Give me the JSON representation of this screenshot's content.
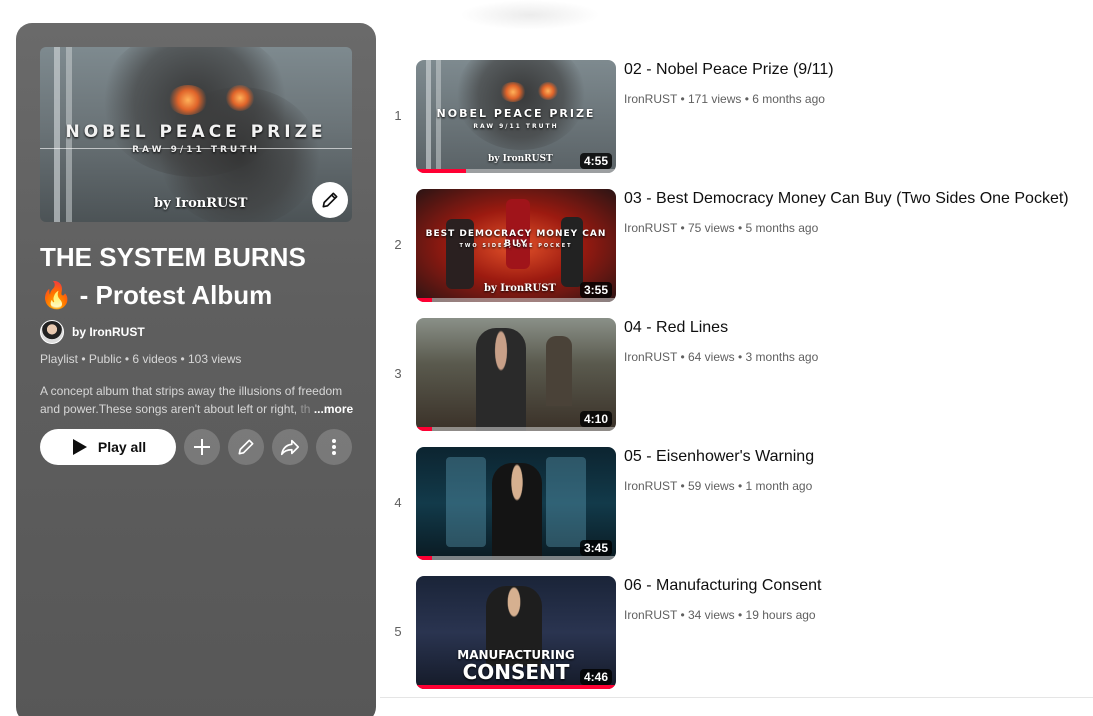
{
  "playlist": {
    "thumb_title": "NOBEL PEACE PRIZE",
    "thumb_subtitle": "RAW 9/11 TRUTH",
    "thumb_by": "by IronRUST",
    "title_line1": "THE SYSTEM BURNS",
    "title_emoji": "🔥",
    "title_line2": " - Protest Album",
    "owner": "by IronRUST",
    "meta": "Playlist • Public • 6 videos • 103 views",
    "description_line1": "A concept album that strips away the illusions of freedom",
    "description_line2": "and power.These songs aren't about left or right, ",
    "description_fade": "th",
    "more_label": "...more",
    "play_all_label": "Play all",
    "icons": {
      "edit": "pencil-icon",
      "add": "plus-icon",
      "share": "share-arrow-icon",
      "more": "vertical-dots-icon",
      "play": "play-icon"
    }
  },
  "videos": [
    {
      "index": "1",
      "title": "02 - Nobel Peace Prize (9/11)",
      "meta": "IronRUST • 171 views • 6 months ago",
      "duration": "4:55",
      "thumb_text": "NOBEL PEACE PRIZE",
      "thumb_sub": "RAW 9/11 TRUTH",
      "thumb_by": "by IronRUST",
      "watched_fraction": 0.25
    },
    {
      "index": "2",
      "title": "03 - Best Democracy Money Can Buy (Two Sides One Pocket)",
      "meta": "IronRUST • 75 views • 5 months ago",
      "duration": "3:55",
      "thumb_text": "BEST DEMOCRACY MONEY CAN BUY",
      "thumb_sub": "TWO SIDES, ONE POCKET",
      "thumb_by": "by IronRUST",
      "watched_fraction": 0.08
    },
    {
      "index": "3",
      "title": "04 - Red Lines",
      "meta": "IronRUST • 64 views • 3 months ago",
      "duration": "4:10",
      "watched_fraction": 0.08
    },
    {
      "index": "4",
      "title": "05 - Eisenhower's Warning",
      "meta": "IronRUST • 59 views • 1 month ago",
      "duration": "3:45",
      "watched_fraction": 0.08
    },
    {
      "index": "5",
      "title": "06 - Manufacturing Consent",
      "meta": "IronRUST • 34 views • 19 hours ago",
      "duration": "4:46",
      "thumb_text": "MANUFACTURING",
      "thumb_text2": "CONSENT",
      "watched_fraction": 1.0
    }
  ],
  "colors": {
    "progress": "#ff0033",
    "panel": "#5f5f5f"
  }
}
